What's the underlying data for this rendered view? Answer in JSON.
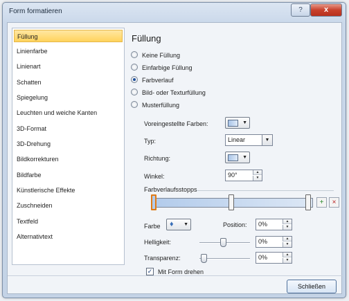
{
  "window": {
    "title": "Form formatieren",
    "help_glyph": "?",
    "close_glyph": "x"
  },
  "sidebar": {
    "items": [
      {
        "label": "Füllung",
        "active": true
      },
      {
        "label": "Linienfarbe"
      },
      {
        "label": "Linienart"
      },
      {
        "label": "Schatten"
      },
      {
        "label": "Spiegelung"
      },
      {
        "label": "Leuchten und weiche Kanten"
      },
      {
        "label": "3D-Format"
      },
      {
        "label": "3D-Drehung"
      },
      {
        "label": "Bildkorrekturen"
      },
      {
        "label": "Bildfarbe"
      },
      {
        "label": "Künstlerische Effekte"
      },
      {
        "label": "Zuschneiden"
      },
      {
        "label": "Textfeld"
      },
      {
        "label": "Alternativtext"
      }
    ]
  },
  "panel": {
    "title": "Füllung",
    "radios": [
      {
        "label": "Keine Füllung",
        "selected": false
      },
      {
        "label": "Einfarbige Füllung",
        "selected": false
      },
      {
        "label": "Farbverlauf",
        "selected": true
      },
      {
        "label": "Bild- oder Texturfüllung",
        "selected": false
      },
      {
        "label": "Musterfüllung",
        "selected": false
      }
    ],
    "preset_label": "Voreingestellte Farben:",
    "type_label": "Typ:",
    "type_value": "Linear",
    "direction_label": "Richtung:",
    "angle_label": "Winkel:",
    "angle_value": "90°",
    "stops_group": "Farbverlaufsstopps",
    "color_label": "Farbe",
    "position_label": "Position:",
    "position_value": "0%",
    "brightness_label": "Helligkeit:",
    "brightness_value": "0%",
    "transparency_label": "Transparenz:",
    "transparency_value": "0%",
    "rotate_label": "Mit Form drehen",
    "rotate_checked": true
  },
  "footer": {
    "close_label": "Schließen"
  },
  "colors": {
    "active_item": "#ffd35c",
    "gradient_start": "#b2cbeb",
    "gradient_end": "#dce7f5",
    "selected_stop_border": "#e07b16"
  }
}
